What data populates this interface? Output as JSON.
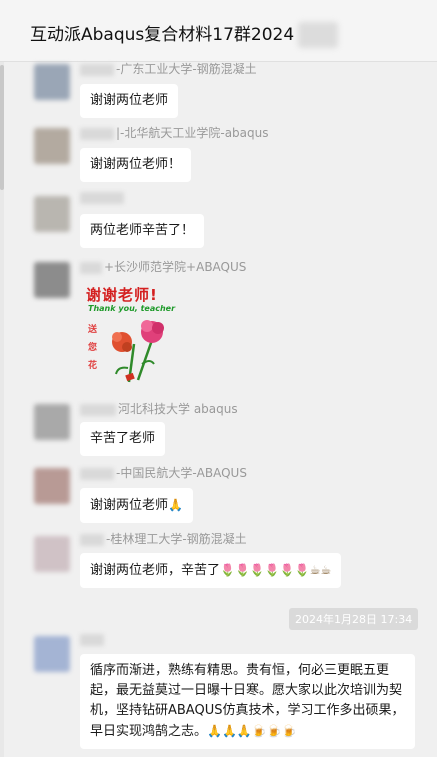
{
  "header": {
    "title": "互动派Abaqus复合材料17群2024"
  },
  "messages": [
    {
      "sender": "-广东工业大学-钢筋混凝土",
      "text": "谢谢两位老师",
      "avatar_color": "#9aa6b6"
    },
    {
      "sender": "|-北华航天工业学院-abaqus",
      "text": "谢谢两位老师！",
      "avatar_color": "#b3aaa0"
    },
    {
      "sender": "",
      "text": "两位老师辛苦了！",
      "avatar_color": "#b9b6b0"
    },
    {
      "sender": "+长沙师范学院+ABAQUS",
      "sticker": {
        "title": "谢谢老师!",
        "subtitle": "Thank you, teacher",
        "v1": "送",
        "v2": "您",
        "v3": "花"
      },
      "avatar_color": "#8c8c8c"
    },
    {
      "sender": "河北科技大学 abaqus",
      "text": "辛苦了老师",
      "avatar_color": "#a9a9a9"
    },
    {
      "sender": "-中国民航大学-ABAQUS",
      "text": "谢谢两位老师",
      "emoji_name": "pray-icon",
      "avatar_color": "#b89a95"
    },
    {
      "sender": "-桂林理工大学-钢筋混凝土",
      "text": "谢谢两位老师，辛苦了",
      "emojis": [
        "tulip-icon",
        "tulip-icon",
        "tulip-icon",
        "tulip-icon",
        "tulip-icon",
        "tulip-icon",
        "coffee-icon",
        "coffee-icon"
      ],
      "avatar_color": "#d0c2c6"
    },
    {
      "sender": "",
      "text": "循序而渐进，熟练有精思。贵有恒，何必三更眠五更起，最无益莫过一日曝十日寒。愿大家以此次培训为契机，坚持钻研ABAQUS仿真技术，学习工作多出硕果，早日实现鸿鹄之志。",
      "emojis": [
        "pray-icon",
        "pray-icon",
        "pray-icon",
        "beer-icon",
        "beer-icon",
        "beer-icon"
      ],
      "avatar_color": "#a4b4d4"
    }
  ],
  "timestamp": "2024年1月28日 17:34"
}
